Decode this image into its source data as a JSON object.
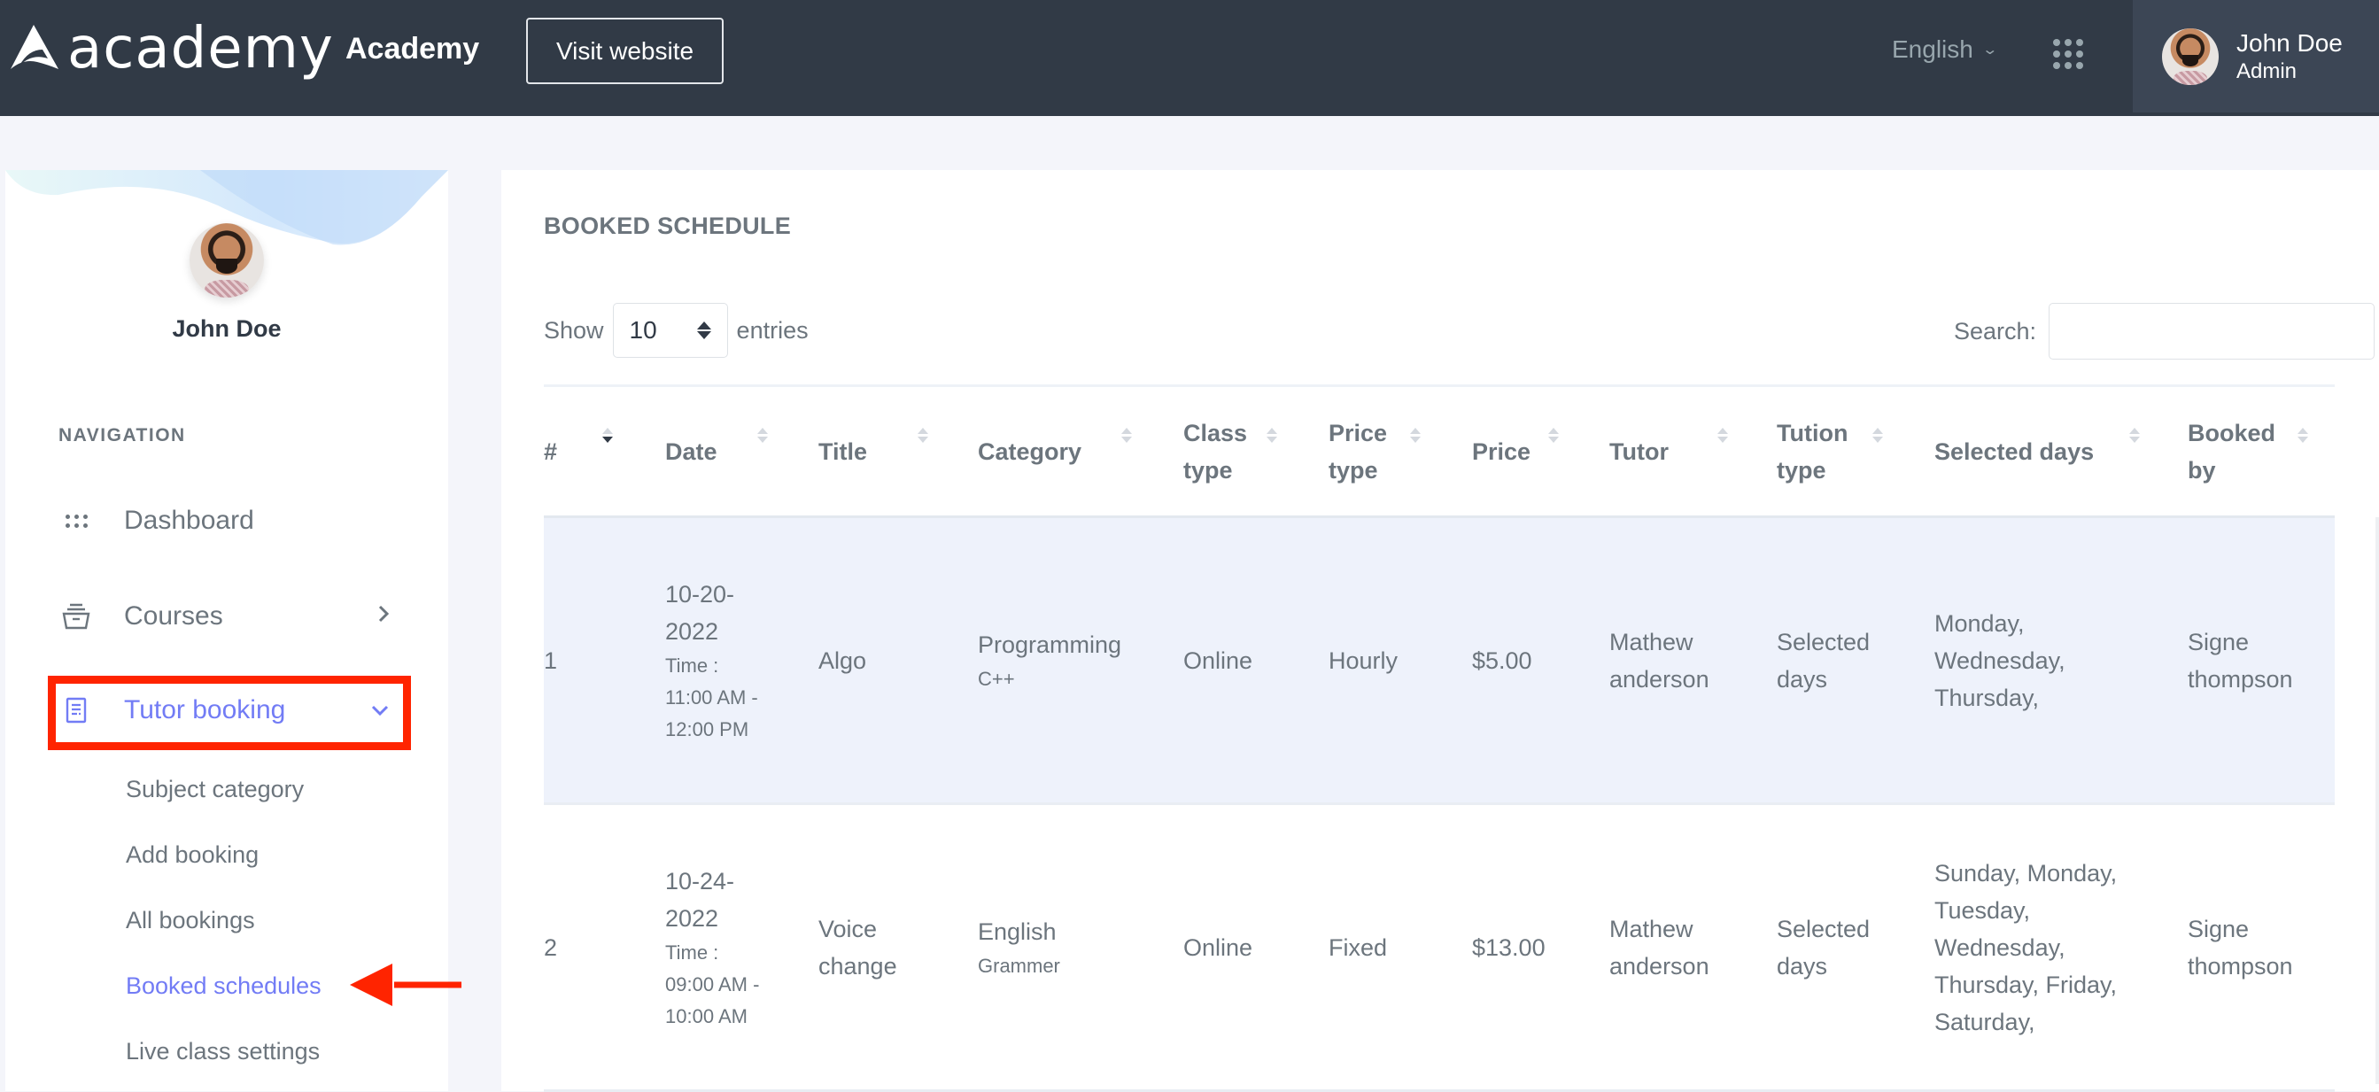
{
  "topbar": {
    "logo_text": "academy",
    "app_name": "Academy",
    "visit_website_label": "Visit website",
    "language": "English",
    "user_name": "John Doe",
    "user_role": "Admin"
  },
  "sidebar": {
    "profile_name": "John Doe",
    "nav_title": "NAVIGATION",
    "items": [
      {
        "label": "Dashboard",
        "icon": "dashboard-grid-icon"
      },
      {
        "label": "Courses",
        "icon": "courses-box-icon",
        "arrow": "chevron-right-icon"
      },
      {
        "label": "Tutor booking",
        "icon": "document-icon",
        "arrow": "chevron-down-icon",
        "active": true
      }
    ],
    "sub_items": [
      {
        "label": "Subject category"
      },
      {
        "label": "Add booking"
      },
      {
        "label": "All bookings"
      },
      {
        "label": "Booked schedules",
        "active": true
      },
      {
        "label": "Live class settings"
      }
    ]
  },
  "main": {
    "title": "BOOKED SCHEDULE",
    "show_label": "Show",
    "entries_label": "entries",
    "page_length": "10",
    "search_label": "Search:",
    "search_value": "",
    "columns": [
      "#",
      "Date",
      "Title",
      "Category",
      "Class type",
      "Price type",
      "Price",
      "Tutor",
      "Tution type",
      "Selected days",
      "Booked by"
    ],
    "rows": [
      {
        "num": "1",
        "date": "10-20-2022",
        "time_label": "Time :",
        "time": "11:00 AM - 12:00 PM",
        "title": "Algo",
        "category": "Programming",
        "subcategory": "C++",
        "class_type": "Online",
        "price_type": "Hourly",
        "price": "$5.00",
        "tutor": "Mathew anderson",
        "tution_type": "Selected days",
        "selected_days": "Monday, Wednesday, Thursday,",
        "booked_by": "Signe thompson"
      },
      {
        "num": "2",
        "date": "10-24-2022",
        "time_label": "Time :",
        "time": "09:00 AM - 10:00 AM",
        "title": "Voice change",
        "category": "English",
        "subcategory": "Grammer",
        "class_type": "Online",
        "price_type": "Fixed",
        "price": "$13.00",
        "tutor": "Mathew anderson",
        "tution_type": "Selected days",
        "selected_days": "Sunday, Monday, Tuesday, Wednesday, Thursday, Friday, Saturday,",
        "booked_by": "Signe thompson"
      }
    ]
  },
  "colors": {
    "topbar_bg": "#313a46",
    "user_box_bg": "#3c4655",
    "accent": "#727cf5",
    "annotation_red": "#ff2400",
    "row_highlight": "#eef2fb"
  }
}
